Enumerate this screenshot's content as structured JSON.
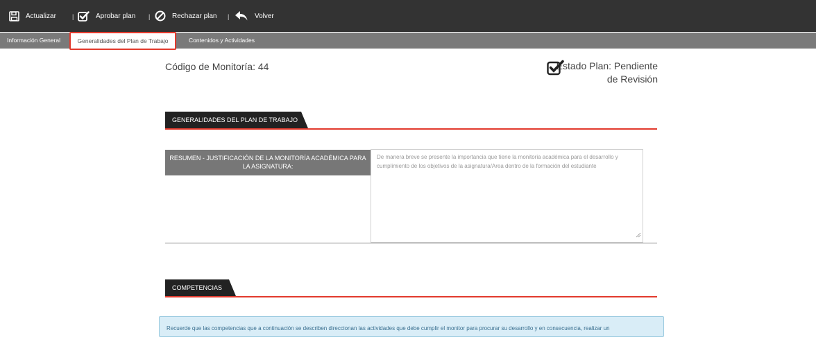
{
  "toolbar": {
    "actualizar": "Actualizar",
    "aprobar": "Aprobar plan",
    "rechazar": "Rechazar plan",
    "volver": "Volver",
    "separator": "|"
  },
  "tabs": [
    {
      "label": "Información General"
    },
    {
      "label": "Generalidades del Plan de Trabajo"
    },
    {
      "label": "Contenidos y Actividades"
    }
  ],
  "header": {
    "code": "Código de Monitoría: 44",
    "estado_line1": "Estado Plan: Pendiente",
    "estado_line2": "de Revisión"
  },
  "sections": {
    "generalidades": "GENERALIDADES DEL PLAN DE TRABAJO",
    "competencias": "COMPETENCIAS"
  },
  "resumen": {
    "label": "RESUMEN - JUSTIFICACIÓN DE LA MONITORÍA ACADÉMICA PARA LA ASIGNATURA:",
    "placeholder": "De manera breve se presente la importancia que tiene la monitoria académica para el desarrollo y cumplimiento de los objetivos de la asignatura/Area dentro de la  formación del estudiante"
  },
  "info_text": "Recuerde que las competencias que a continuación se describen direccionan las actividades que debe cumplir el monitor para procurar su desarrollo y en consecuencia, realizar un",
  "icons": {
    "actualizar": "save-icon",
    "aprobar": "check-square-icon",
    "rechazar": "ban-icon",
    "volver": "reply-arrow-icon",
    "estado": "check-square-icon"
  },
  "colors": {
    "toolbar": "#333333",
    "tabbar": "#7a7a7a",
    "accent": "#e23a2d",
    "section_tab": "#222222",
    "info_bg": "#d9edf7"
  }
}
